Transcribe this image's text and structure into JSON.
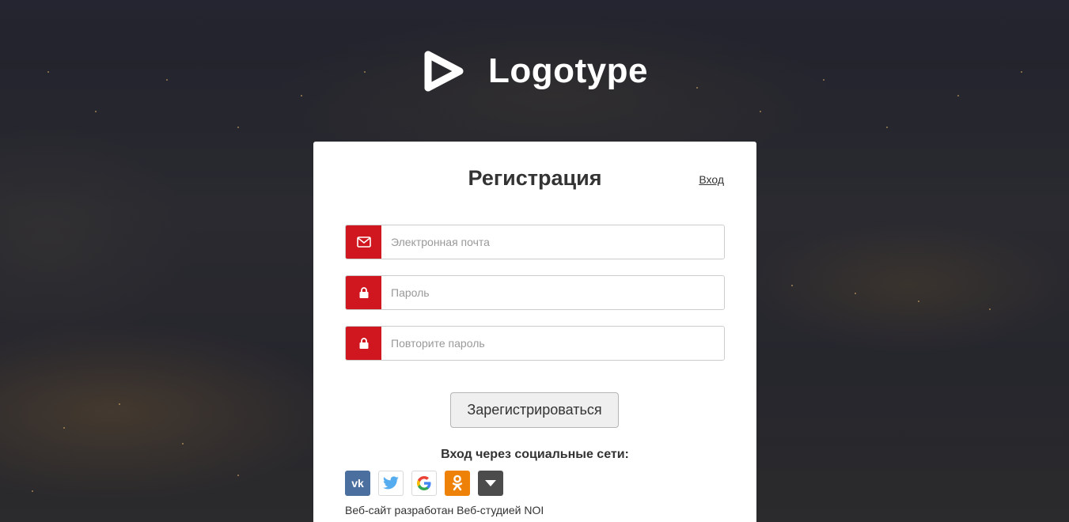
{
  "logo": {
    "text": "Logotype",
    "icon": "play-triangle-icon"
  },
  "form": {
    "title": "Регистрация",
    "login_link": "Вход",
    "email": {
      "placeholder": "Электронная почта",
      "value": "",
      "icon": "envelope-icon"
    },
    "password": {
      "placeholder": "Пароль",
      "value": "",
      "icon": "lock-icon"
    },
    "password_repeat": {
      "placeholder": "Повторите пароль",
      "value": "",
      "icon": "lock-icon"
    },
    "submit_label": "Зарегистрироваться",
    "social_title": "Вход через социальные сети:",
    "social_icons": [
      "vk-icon",
      "twitter-icon",
      "google-icon",
      "odnoklassniki-icon",
      "more-dropdown-icon"
    ],
    "footer_note": "Веб-сайт разработан Веб-студией NOI"
  },
  "colors": {
    "accent": "#d0161e",
    "vk": "#4b6f9e",
    "odnoklassniki": "#ee8208",
    "twitter": "#55acee",
    "more": "#4c4c4c"
  }
}
